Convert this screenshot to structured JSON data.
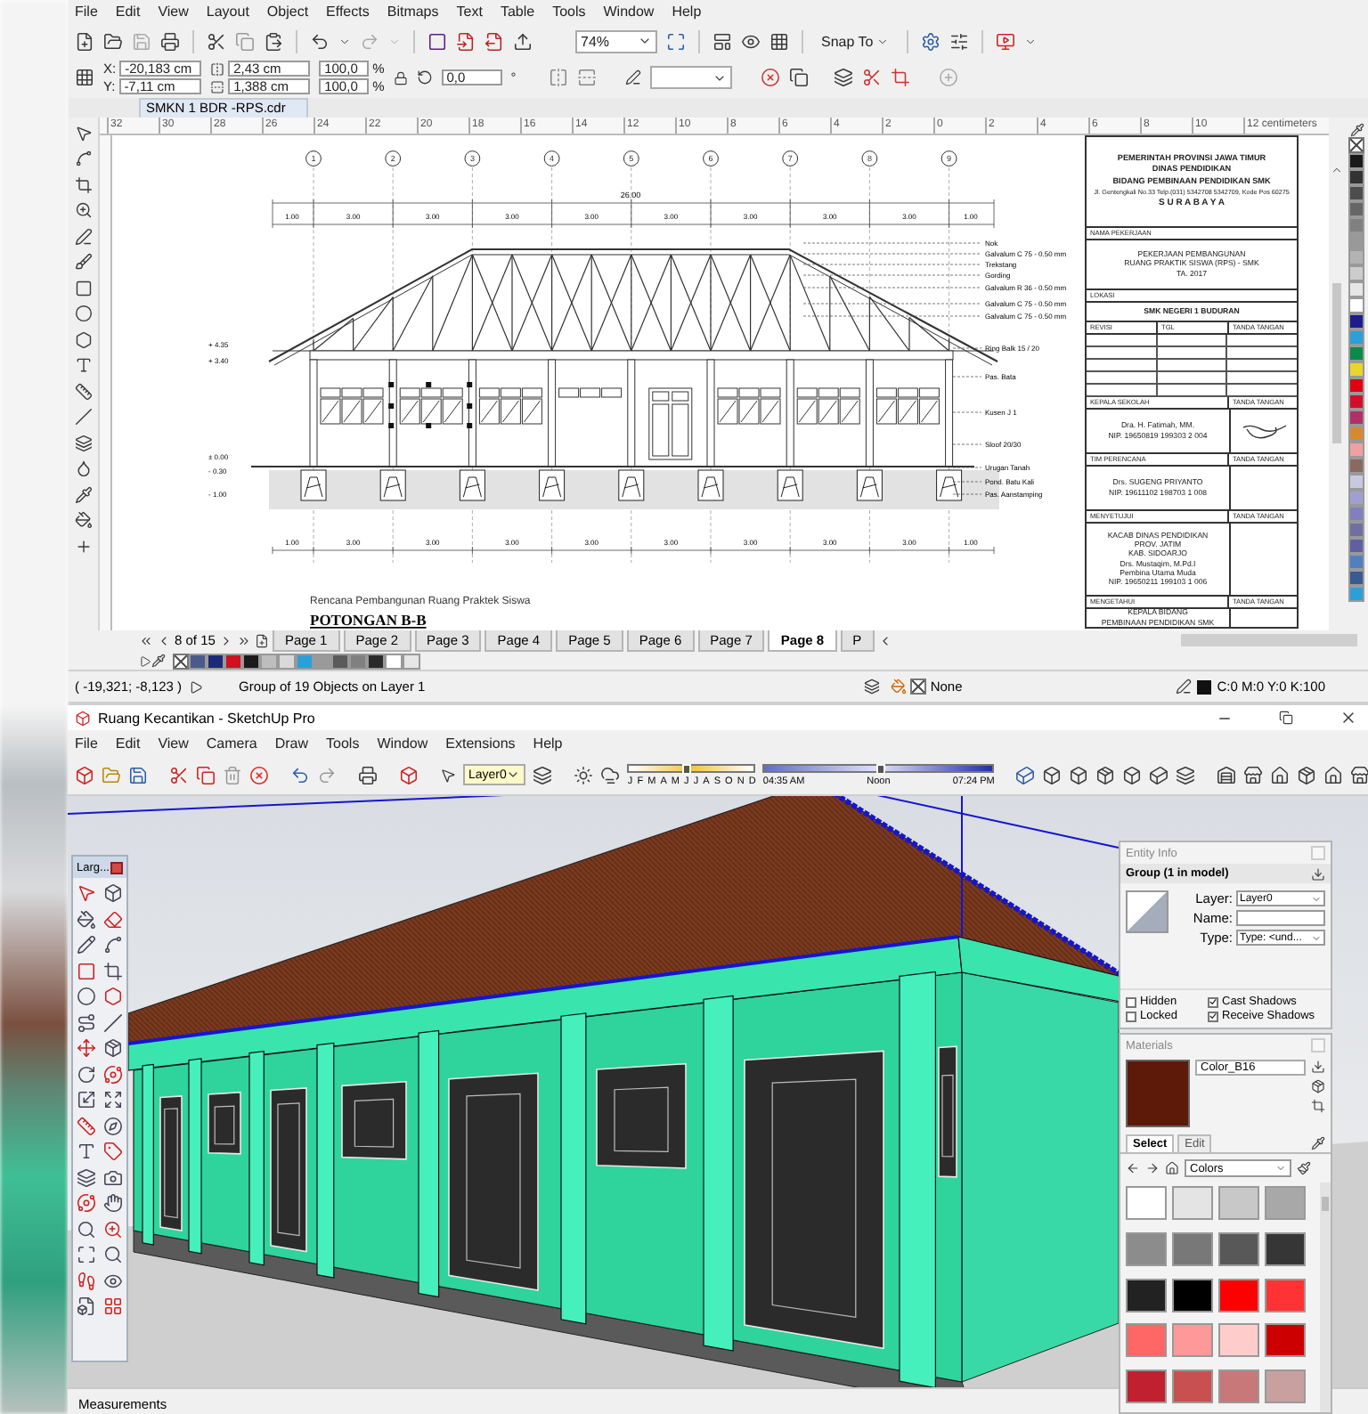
{
  "corel": {
    "menu": [
      "File",
      "Edit",
      "View",
      "Layout",
      "Object",
      "Effects",
      "Bitmaps",
      "Text",
      "Table",
      "Tools",
      "Window",
      "Help"
    ],
    "zoom": "74%",
    "snap": "Snap To",
    "position": [
      {
        "label": "X:",
        "value": "-20,183 cm"
      },
      {
        "label": "Y:",
        "value": "-7,11 cm"
      }
    ],
    "size": [
      "2,43 cm",
      "1,388 cm"
    ],
    "scale": [
      {
        "value": "100,0",
        "unit": "%"
      },
      {
        "value": "100,0",
        "unit": "%"
      }
    ],
    "rotation": {
      "value": "0,0",
      "unit": "°"
    },
    "document_tab": "SMKN 1 BDR -RPS.cdr",
    "ruler": [
      "32",
      "30",
      "28",
      "26",
      "24",
      "22",
      "20",
      "18",
      "16",
      "14",
      "12",
      "10",
      "8",
      "6",
      "4",
      "2",
      "0",
      "2",
      "4",
      "6",
      "8",
      "10",
      "12 centimeters"
    ],
    "drawing": {
      "axes": [
        "1",
        "2",
        "3",
        "4",
        "5",
        "6",
        "7",
        "8",
        "9"
      ],
      "overall_dimension": "26.00",
      "top_dimensions": [
        "1.00",
        "3.00",
        "3.00",
        "3.00",
        "3.00",
        "3.00",
        "3.00",
        "3.00",
        "3.00",
        "1.00"
      ],
      "bottom_dimensions": [
        "1.00",
        "3.00",
        "3.00",
        "3.00",
        "3.00",
        "3.00",
        "3.00",
        "3.00",
        "3.00",
        "1.00"
      ],
      "level_marks": [
        "+ 4.35",
        "+ 3.40",
        "± 0.00",
        "- 0.30",
        "- 1.00"
      ],
      "callouts": [
        "Nok",
        "Galvalum C 75 - 0.50 mm",
        "Trekstang",
        "Gording",
        "Galvalum R 36 - 0.50 mm",
        "Galvalum C 75 - 0.50 mm",
        "Galvalum C 75 - 0.50 mm",
        "Ring Balk 15 / 20",
        "Pas. Bata",
        "Kusen J 1",
        "Sloof 20/30",
        "Urugan Tanah",
        "Pond. Batu Kali",
        "Pas. Aanstamping"
      ],
      "subtitle": "Rencana Pembangunan Ruang Praktek Siswa",
      "title": "POTONGAN B-B"
    },
    "title_block": {
      "header": [
        "PEMERINTAH PROVINSI JAWA TIMUR",
        "DINAS PENDIDIKAN",
        "BIDANG PEMBINAAN PENDIDIKAN SMK"
      ],
      "address": "Jl. Gentengkali No.33 Telp.(031) 5342708 5342709, Kode Pos 60275",
      "city": "S U R A B A Y A",
      "job_label": "NAMA PEKERJAAN",
      "job": [
        "PEKERJAAN PEMBANGUNAN",
        "RUANG PRAKTIK SISWA (RPS) - SMK",
        "TA. 2017"
      ],
      "location_label": "LOKASI",
      "location": "SMK NEGERI 1 BUDURAN",
      "revision_columns": [
        "REVISI",
        "TGL",
        "TANDA TANGAN"
      ],
      "signatories": [
        {
          "role": "KEPALA SEKOLAH",
          "sign_label": "TANDA TANGAN",
          "lines": [
            "Dra. H. Fatimah, MM.",
            "NIP. 19650819 199303 2 004"
          ],
          "signed": true
        },
        {
          "role": "TIM PERENCANA",
          "sign_label": "TANDA TANGAN",
          "lines": [
            "Drs. SUGENG PRIYANTO",
            "NIP. 19611102 198703 1 008"
          ],
          "signed": false
        },
        {
          "role": "MENYETUJUI",
          "sign_label": "TANDA TANGAN",
          "lines": [
            "KACAB DINAS PENDIDIKAN",
            "PROV. JATIM",
            "KAB. SIDOARJO",
            "Drs. Mustaqim, M.Pd.I",
            "Pembina Utama Muda",
            "NIP. 19650211 199103 1 006"
          ],
          "signed": false
        },
        {
          "role": "MENGETAHUI",
          "sign_label": "TANDA TANGAN",
          "lines": [
            "KEPALA BIDANG",
            "PEMBINAAN PENDIDIKAN SMK"
          ],
          "signed": false
        }
      ]
    },
    "page_counter": "8 of 15",
    "pages": [
      {
        "label": "Page 1",
        "selected": false
      },
      {
        "label": "Page 2",
        "selected": false
      },
      {
        "label": "Page 3",
        "selected": false
      },
      {
        "label": "Page 4",
        "selected": false
      },
      {
        "label": "Page 5",
        "selected": false
      },
      {
        "label": "Page 6",
        "selected": false
      },
      {
        "label": "Page 7",
        "selected": false
      },
      {
        "label": "Page 8",
        "selected": true
      },
      {
        "label": "P",
        "selected": false
      }
    ],
    "palette": [
      {
        "color": "#1a1a1a"
      },
      {
        "color": "#333333"
      },
      {
        "color": "#4d4d4d"
      },
      {
        "color": "#666666"
      },
      {
        "color": "#808080"
      },
      {
        "color": "#999999"
      },
      {
        "color": "#b3b3b3"
      },
      {
        "color": "#cccccc"
      },
      {
        "color": "#e6e6e6"
      },
      {
        "color": "#ffffff"
      },
      {
        "color": "#1c1c8c"
      },
      {
        "color": "#2ba0d8"
      },
      {
        "color": "#0b8a4a"
      },
      {
        "color": "#e8d62c"
      },
      {
        "color": "#e00010"
      },
      {
        "color": "#d0102a"
      },
      {
        "color": "#b0306a"
      },
      {
        "color": "#d68a30"
      },
      {
        "color": "#f0a0a0"
      },
      {
        "color": "#8a6a60"
      },
      {
        "color": "#c8c8e0"
      },
      {
        "color": "#a0a0d0"
      },
      {
        "color": "#8080c0"
      },
      {
        "color": "#7070a0"
      },
      {
        "color": "#6060a0"
      },
      {
        "color": "#5080c0"
      },
      {
        "color": "#3a5a90"
      },
      {
        "color": "#2ba0d8"
      }
    ],
    "document_palette": [
      {
        "color": "#4a5a8a"
      },
      {
        "color": "#1c2a7a"
      },
      {
        "color": "#d01020"
      },
      {
        "color": "#1a1a1a"
      },
      {
        "color": "#bdbdbd"
      },
      {
        "color": "#d9d9d9"
      },
      {
        "color": "#2ba0d8"
      },
      {
        "color": "#9a9a9a"
      },
      {
        "color": "#5a5a5a"
      },
      {
        "color": "#808080"
      },
      {
        "color": "#2a2a2a"
      },
      {
        "color": "#ffffff"
      },
      {
        "color": "#e6e6e6"
      }
    ],
    "status": {
      "coords": "( -19,321; -8,123 )",
      "message": "Group of 19 Objects on Layer 1",
      "fill": "None",
      "outline": "C:0 M:0 Y:0 K:100"
    }
  },
  "sketchup": {
    "title": "Ruang Kecantikan - SketchUp Pro",
    "menu": [
      "File",
      "Edit",
      "View",
      "Camera",
      "Draw",
      "Tools",
      "Window",
      "Extensions",
      "Help"
    ],
    "layer": "Layer0",
    "months": [
      "J",
      "F",
      "M",
      "A",
      "M",
      "J",
      "J",
      "A",
      "S",
      "O",
      "N",
      "D"
    ],
    "date_slider": {
      "level": 0.45
    },
    "time_slider": {
      "level": 0.5
    },
    "times": [
      "04:35 AM",
      "Noon",
      "07:24 PM"
    ],
    "toolbar_title": "Larg...",
    "entity_info": {
      "title": "Entity Info",
      "selection": "Group (1 in model)",
      "fields": [
        {
          "label": "Layer:",
          "value": "Layer0",
          "kind": "dropdown"
        },
        {
          "label": "Name:",
          "kind": "input"
        },
        {
          "label": "Type:",
          "value": "Type: <und...",
          "kind": "dropdown"
        }
      ],
      "options": [
        {
          "label": "Hidden",
          "checked": false
        },
        {
          "label": "Cast Shadows",
          "checked": true
        },
        {
          "label": "Locked",
          "checked": false
        },
        {
          "label": "Receive Shadows",
          "checked": true
        }
      ]
    },
    "materials": {
      "title": "Materials",
      "name": "Color_B16",
      "color": "#5e1a08",
      "tabs": [
        {
          "label": "Select",
          "selected": true
        },
        {
          "label": "Edit",
          "selected": false
        }
      ],
      "collection": "Colors",
      "swatches": [
        {
          "color": "#ffffff"
        },
        {
          "color": "#e4e4e4"
        },
        {
          "color": "#c8c8c8"
        },
        {
          "color": "#a8a8a8"
        },
        {
          "color": "#8c8c8c"
        },
        {
          "color": "#787878"
        },
        {
          "color": "#585858"
        },
        {
          "color": "#363636"
        },
        {
          "color": "#222222"
        },
        {
          "color": "#000000"
        },
        {
          "color": "#ff0000"
        },
        {
          "color": "#ff3333"
        },
        {
          "color": "#ff6666"
        },
        {
          "color": "#ff9999"
        },
        {
          "color": "#ffcccc"
        },
        {
          "color": "#cc0000"
        },
        {
          "color": "#c02030"
        },
        {
          "color": "#c85050"
        },
        {
          "color": "#c87878"
        },
        {
          "color": "#c8a0a0"
        }
      ]
    },
    "measurements": "Measurements"
  }
}
